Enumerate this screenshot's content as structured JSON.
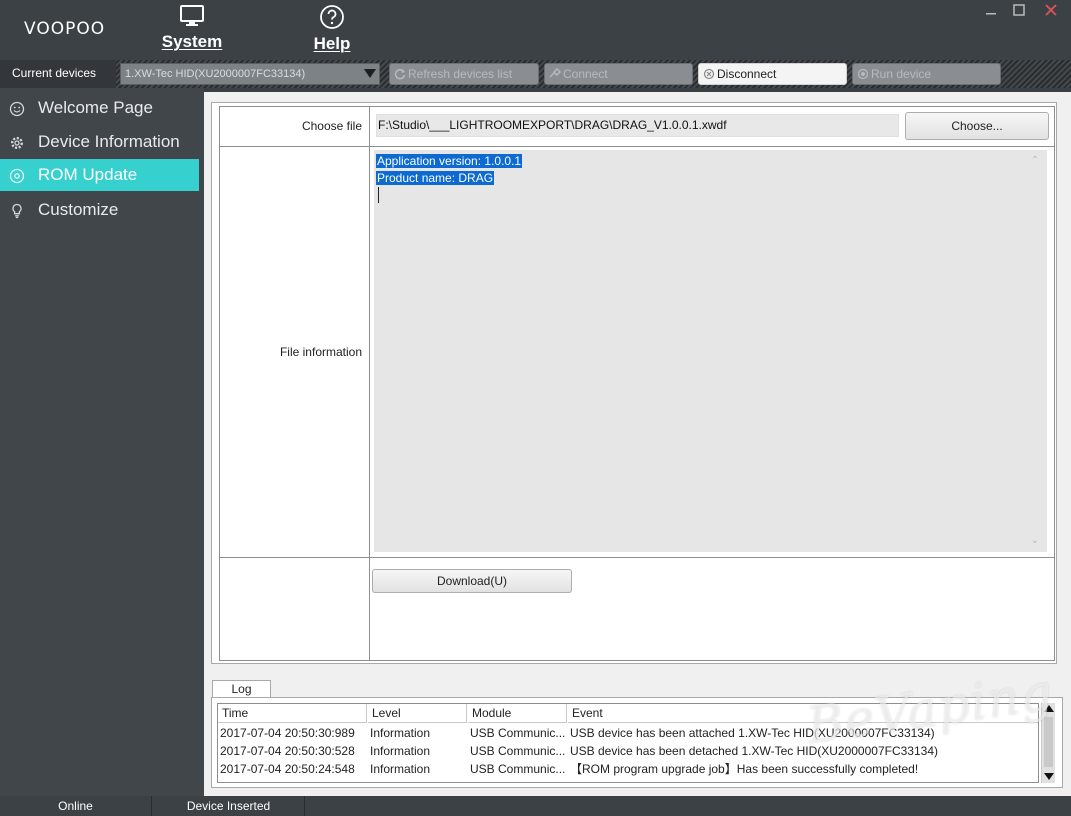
{
  "app": {
    "logo_text": "VOOPOO"
  },
  "menu": {
    "system_label": "System",
    "help_label": "Help"
  },
  "toolbar": {
    "current_devices_label": "Current devices",
    "device_selected": "1.XW-Tec HID(XU2000007FC33134)",
    "refresh_label": "Refresh devices list",
    "connect_label": "Connect",
    "disconnect_label": "Disconnect",
    "run_label": "Run device"
  },
  "sidebar": {
    "items": [
      {
        "label": "Welcome Page",
        "icon": "smiley-icon"
      },
      {
        "label": "Device Information",
        "icon": "gear-icon"
      },
      {
        "label": "ROM Update",
        "icon": "disc-icon",
        "active": true
      },
      {
        "label": "Customize",
        "icon": "bulb-icon"
      }
    ]
  },
  "rom": {
    "choose_file_label": "Choose file",
    "file_path": "F:\\Studio\\___LIGHTROOMEXPORT\\DRAG\\DRAG_V1.0.0.1.xwdf",
    "choose_button": "Choose...",
    "file_info_label": "File information",
    "file_info_line1": "Application version: 1.0.0.1",
    "file_info_line2": "Product name: DRAG",
    "download_button": "Download(U)"
  },
  "log": {
    "tab_label": "Log",
    "columns": [
      "Time",
      "Level",
      "Module",
      "Event"
    ],
    "rows": [
      {
        "time": "2017-07-04 20:50:30:989",
        "level": "Information",
        "module": "USB Communic...",
        "event": "USB device has been attached 1.XW-Tec HID(XU2000007FC33134)"
      },
      {
        "time": "2017-07-04 20:50:30:528",
        "level": "Information",
        "module": "USB Communic...",
        "event": "USB device has been detached 1.XW-Tec HID(XU2000007FC33134)"
      },
      {
        "time": "2017-07-04 20:50:24:548",
        "level": "Information",
        "module": "USB Communic...",
        "event": "【ROM program upgrade job】Has been successfully completed!"
      }
    ]
  },
  "status": {
    "online": "Online",
    "device": "Device Inserted"
  },
  "watermark_text": "BeVaping",
  "colors": {
    "accent": "#36d1cf",
    "sidebar_bg": "#41464b",
    "titlebar_bg": "#3c4146"
  }
}
